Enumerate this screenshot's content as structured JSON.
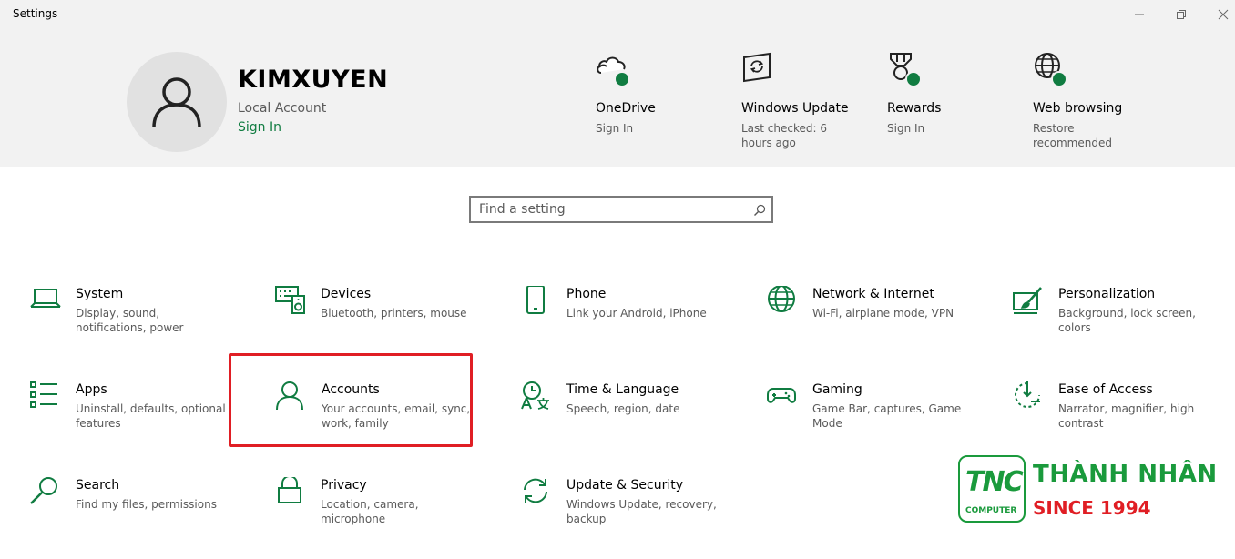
{
  "window": {
    "title": "Settings",
    "controls": [
      "minimize-icon",
      "restore-icon",
      "close-icon"
    ]
  },
  "account": {
    "username": "KIMXUYEN",
    "type": "Local Account",
    "sign_in": "Sign In"
  },
  "quick_actions": [
    {
      "label": "OneDrive",
      "sub": "Sign In",
      "icon": "onedrive-cloud-icon"
    },
    {
      "label": "Windows Update",
      "sub": "Last checked: 6 hours ago",
      "icon": "windows-update-icon"
    },
    {
      "label": "Rewards",
      "sub": "Sign In",
      "icon": "rewards-medal-icon"
    },
    {
      "label": "Web browsing",
      "sub": "Restore recommended",
      "icon": "globe-icon"
    }
  ],
  "search": {
    "placeholder": "Find a setting",
    "icon": "search-icon"
  },
  "categories": [
    {
      "name": "System",
      "desc": "Display, sound, notifications, power",
      "icon": "laptop-icon"
    },
    {
      "name": "Devices",
      "desc": "Bluetooth, printers, mouse",
      "icon": "keyboard-speaker-icon"
    },
    {
      "name": "Phone",
      "desc": "Link your Android, iPhone",
      "icon": "phone-icon"
    },
    {
      "name": "Network & Internet",
      "desc": "Wi-Fi, airplane mode, VPN",
      "icon": "globe-icon"
    },
    {
      "name": "Personalization",
      "desc": "Background, lock screen, colors",
      "icon": "paint-brush-icon"
    },
    {
      "name": "Apps",
      "desc": "Uninstall, defaults, optional features",
      "icon": "apps-list-icon"
    },
    {
      "name": "Accounts",
      "desc": "Your accounts, email, sync, work, family",
      "icon": "person-icon"
    },
    {
      "name": "Time & Language",
      "desc": "Speech, region, date",
      "icon": "time-language-icon"
    },
    {
      "name": "Gaming",
      "desc": "Game Bar, captures, Game Mode",
      "icon": "gamepad-icon"
    },
    {
      "name": "Ease of Access",
      "desc": "Narrator, magnifier, high contrast",
      "icon": "ease-of-access-icon"
    },
    {
      "name": "Search",
      "desc": "Find my files, permissions",
      "icon": "search-icon"
    },
    {
      "name": "Privacy",
      "desc": "Location, camera, microphone",
      "icon": "lock-icon"
    },
    {
      "name": "Update & Security",
      "desc": "Windows Update, recovery, backup",
      "icon": "sync-arrows-icon"
    }
  ],
  "watermark": {
    "badge": "TNC",
    "badge_sub": "COMPUTER",
    "name": "THÀNH NHÂN",
    "since": "SINCE 1994"
  },
  "colors": {
    "accent": "#107c41",
    "header_bg": "#f2f2f2",
    "highlight": "#e01e24"
  }
}
